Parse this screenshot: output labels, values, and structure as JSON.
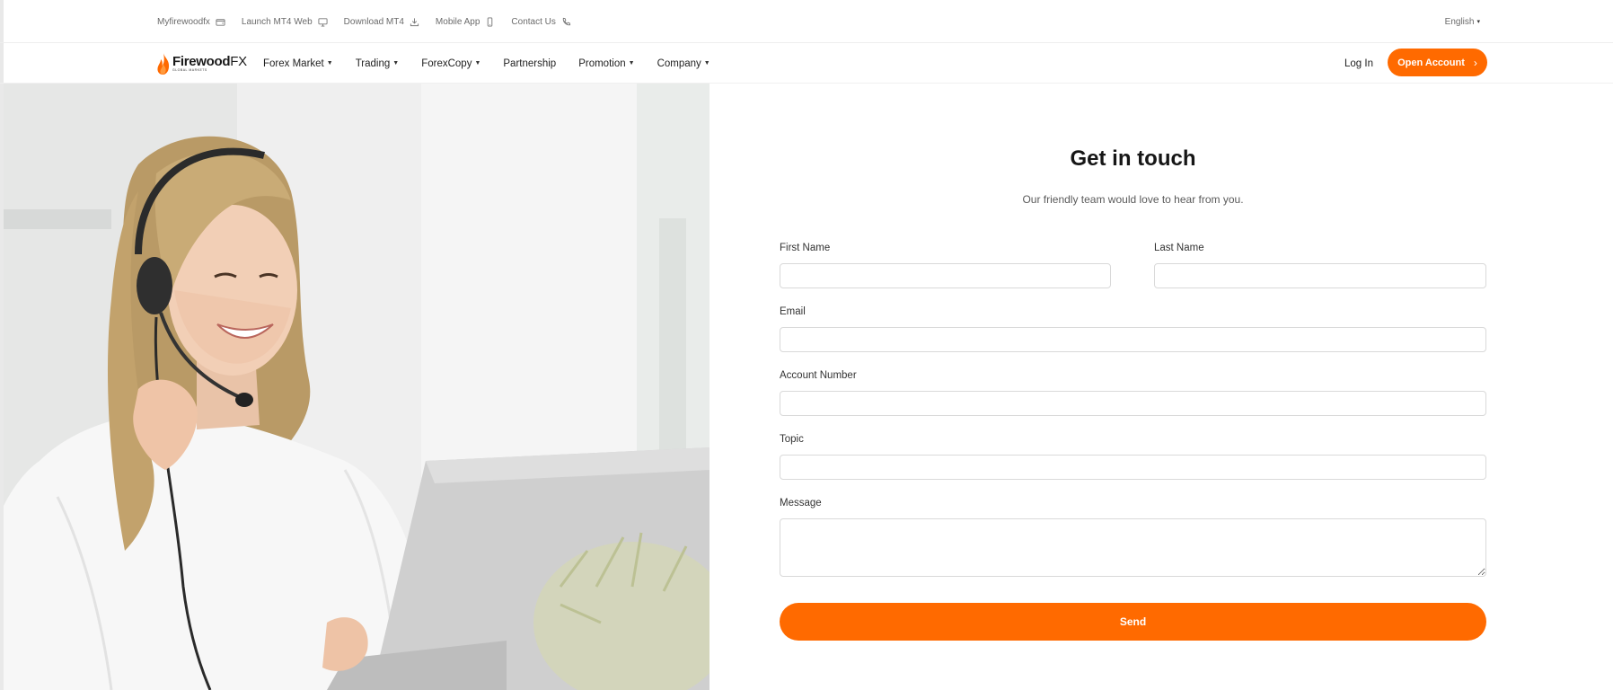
{
  "topbar": {
    "links": [
      {
        "label": "Myfirewoodfx",
        "icon": "wallet-icon"
      },
      {
        "label": "Launch MT4 Web",
        "icon": "monitor-icon"
      },
      {
        "label": "Download MT4",
        "icon": "download-icon"
      },
      {
        "label": "Mobile App",
        "icon": "phone-icon"
      },
      {
        "label": "Contact Us",
        "icon": "telephone-icon"
      }
    ],
    "language": "English"
  },
  "brand": {
    "name_bold": "Firewood",
    "name_light": "FX",
    "tagline": "GLOBAL MARKETS"
  },
  "nav": {
    "items": [
      {
        "label": "Forex Market",
        "dropdown": true
      },
      {
        "label": "Trading",
        "dropdown": true
      },
      {
        "label": "ForexCopy",
        "dropdown": true
      },
      {
        "label": "Partnership",
        "dropdown": false
      },
      {
        "label": "Promotion",
        "dropdown": true
      },
      {
        "label": "Company",
        "dropdown": true
      }
    ],
    "login_label": "Log In",
    "open_account_label": "Open Account"
  },
  "form": {
    "title": "Get in touch",
    "subtitle": "Our friendly team would love to hear from you.",
    "first_name_label": "First Name",
    "first_name_value": "",
    "last_name_label": "Last Name",
    "last_name_value": "",
    "email_label": "Email",
    "email_value": "",
    "account_number_label": "Account Number",
    "account_number_value": "",
    "topic_label": "Topic",
    "topic_value": "",
    "message_label": "Message",
    "message_value": "",
    "send_label": "Send"
  },
  "colors": {
    "accent": "#ff6a00",
    "text": "#1a1a1a",
    "muted": "#6b6b6b",
    "border": "#d9d9d9"
  }
}
